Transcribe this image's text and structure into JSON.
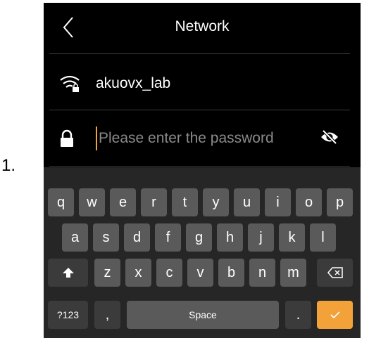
{
  "step": "1.",
  "header": {
    "title": "Network"
  },
  "network": {
    "ssid": "akuovx_lab"
  },
  "password": {
    "placeholder": "Please enter the password",
    "value": ""
  },
  "keyboard": {
    "row1": [
      "q",
      "w",
      "e",
      "r",
      "t",
      "y",
      "u",
      "i",
      "o",
      "p"
    ],
    "row2": [
      "a",
      "s",
      "d",
      "f",
      "g",
      "h",
      "j",
      "k",
      "l"
    ],
    "row3": [
      "z",
      "x",
      "c",
      "v",
      "b",
      "n",
      "m"
    ],
    "bottom": {
      "numbers": "?123",
      "comma": ",",
      "space": "Space",
      "period": "."
    }
  },
  "colors": {
    "accent": "#f3a23a",
    "background": "#000000",
    "key": "#5a5a5a"
  },
  "icons": {
    "back": "chevron-left-icon",
    "wifi": "wifi-lock-icon",
    "lock": "lock-icon",
    "visibility": "eye-off-icon",
    "shift": "shift-arrow-icon",
    "delete": "backspace-icon",
    "confirm": "check-icon"
  }
}
